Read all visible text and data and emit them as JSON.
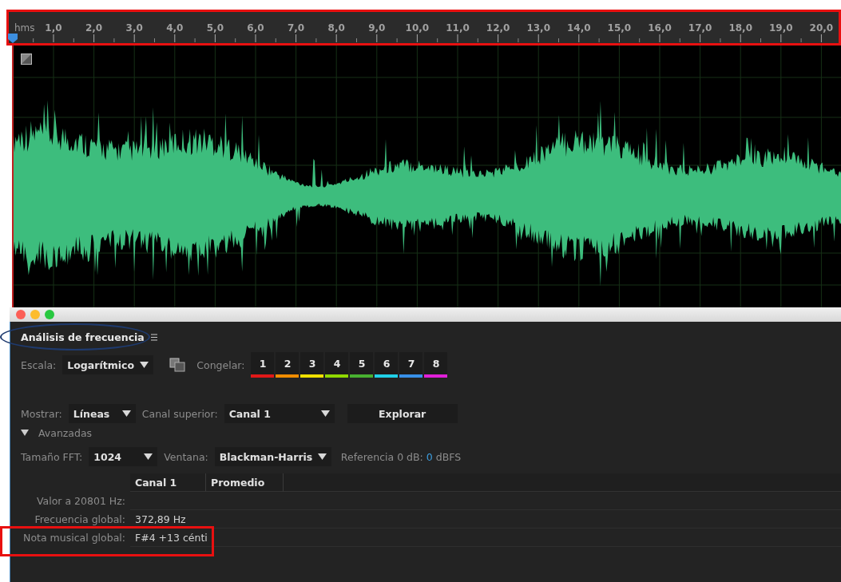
{
  "ruler": {
    "unit": "hms",
    "ticks": [
      "1,0",
      "2,0",
      "3,0",
      "4,0",
      "5,0",
      "6,0",
      "7,0",
      "8,0",
      "9,0",
      "10,0",
      "11,0",
      "12,0",
      "13,0",
      "14,0",
      "15,0",
      "16,0",
      "17,0",
      "18,0",
      "19,0",
      "20,0"
    ]
  },
  "annotations": [
    {
      "kind": "ruler_frame",
      "color": "#e81010"
    },
    {
      "kind": "title_ellipse",
      "color": "#1e3a6e"
    },
    {
      "kind": "note_frame",
      "color": "#e81010"
    }
  ],
  "panel": {
    "title": "Análisis de frecuencia",
    "scale": {
      "label": "Escala:",
      "value": "Logarítmico"
    },
    "freeze": {
      "label": "Congelar:",
      "slots": [
        {
          "label": "1",
          "color": "#e01818"
        },
        {
          "label": "2",
          "color": "#f08c00"
        },
        {
          "label": "3",
          "color": "#f0e000"
        },
        {
          "label": "4",
          "color": "#90d800"
        },
        {
          "label": "5",
          "color": "#48b030"
        },
        {
          "label": "6",
          "color": "#20d0e8"
        },
        {
          "label": "7",
          "color": "#3890e8"
        },
        {
          "label": "8",
          "color": "#e020d8"
        }
      ]
    },
    "show": {
      "label": "Mostrar:",
      "value": "Líneas"
    },
    "top_channel": {
      "label": "Canal superior:",
      "value": "Canal 1"
    },
    "explore_button": "Explorar",
    "advanced": {
      "label": "Avanzadas",
      "expanded": true
    },
    "fft_size": {
      "label": "Tamaño FFT:",
      "value": "1024"
    },
    "window": {
      "label": "Ventana:",
      "value": "Blackman-Harris"
    },
    "reference": {
      "label": "Referencia 0 dB:",
      "value": "0",
      "unit": "dBFS"
    },
    "table": {
      "columns": [
        "Canal 1",
        "Promedio"
      ],
      "rows": [
        {
          "label": "Valor a 20801 Hz:"
        },
        {
          "label": "Frecuencia global:",
          "channel_1": "372,89 Hz"
        },
        {
          "label": "Nota musical global:",
          "channel_1": "F#4 +13 cénti"
        }
      ]
    }
  }
}
